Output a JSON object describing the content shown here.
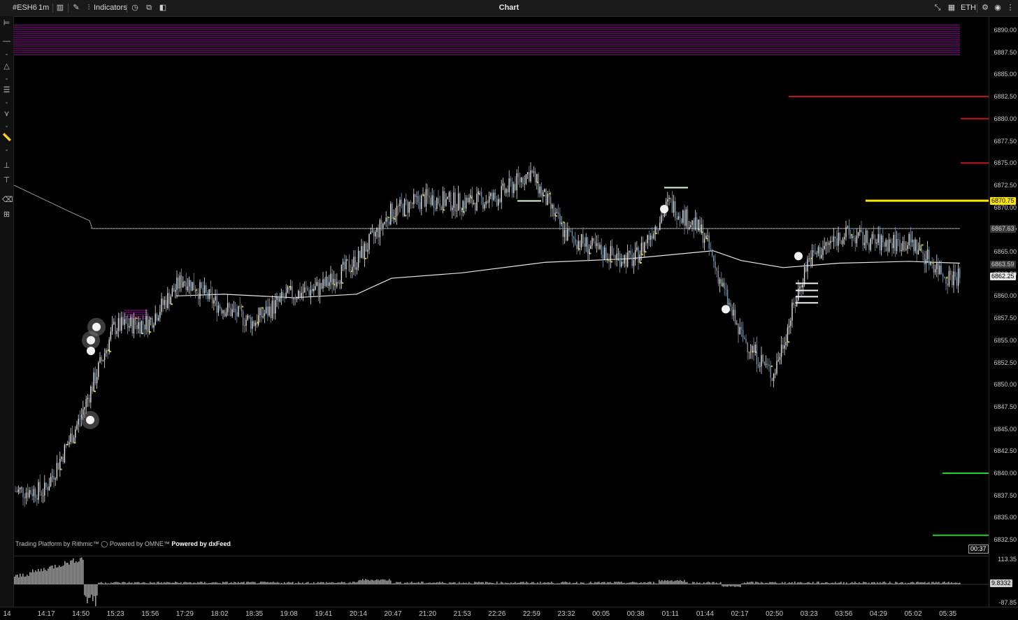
{
  "titlebar": {
    "symbol": "#ESH6",
    "interval": "1m",
    "indicators_label": "Indicators",
    "title": "Chart",
    "session": "ETH"
  },
  "price_axis": {
    "labels": [
      "6890.00",
      "6887.50",
      "6885.00",
      "6882.50",
      "6880.00",
      "6877.50",
      "6875.00",
      "6872.50",
      "6870.00",
      "6867.50",
      "6865.00",
      "6862.50",
      "6860.00",
      "6857.50",
      "6855.00",
      "6852.50",
      "6850.00",
      "6847.50",
      "6845.00",
      "6842.50",
      "6840.00",
      "6837.50",
      "6835.00",
      "6832.50"
    ],
    "tags": [
      {
        "text": "6870.75",
        "bg": "#ffe600",
        "fg": "#000000"
      },
      {
        "text": "6867.63",
        "bg": "#3a3a3a",
        "fg": "#cfcfcf"
      },
      {
        "text": "6863.59",
        "bg": "#3a3a3a",
        "fg": "#cfcfcf"
      },
      {
        "text": "6862.25",
        "bg": "#e6e6e6",
        "fg": "#000000"
      }
    ]
  },
  "volume_axis": {
    "top": "113.35",
    "bottom": "-87.85",
    "tag": "9.8332"
  },
  "time_axis": [
    "14",
    "14:17",
    "14:50",
    "15:23",
    "15:56",
    "17:29",
    "18:02",
    "18:35",
    "19:08",
    "19:41",
    "20:14",
    "20:47",
    "21:20",
    "21:53",
    "22:26",
    "22:59",
    "23:32",
    "00:05",
    "00:38",
    "01:11",
    "01:44",
    "02:17",
    "02:50",
    "03:23",
    "03:56",
    "04:29",
    "05:02",
    "05:35"
  ],
  "credits": {
    "rithmic": "Trading Platform by Rithmic™",
    "omne": "Powered by OMNE™",
    "dxfeed": "Powered by dxFeed"
  },
  "timer": "00:37",
  "colors": {
    "resistance": "#c01818",
    "support": "#22d022",
    "last_price": "#ffe600",
    "zone": "#b01ab0"
  },
  "chart_data": {
    "type": "candlestick",
    "price_levels": {
      "resistance": [
        6882.5,
        6880.0,
        6875.0
      ],
      "support": [
        6840.0,
        6833.0
      ],
      "last_price": 6870.75,
      "dotted_level": 6867.63,
      "vwap": 6863.59,
      "current": 6862.25
    },
    "approx_close_path": [
      {
        "t": "14:17",
        "p": 6838
      },
      {
        "t": "14:50",
        "p": 6846
      },
      {
        "t": "15:23",
        "p": 6856.5
      },
      {
        "t": "15:56",
        "p": 6857
      },
      {
        "t": "17:29",
        "p": 6862
      },
      {
        "t": "18:02",
        "p": 6859
      },
      {
        "t": "18:35",
        "p": 6857
      },
      {
        "t": "19:08",
        "p": 6860
      },
      {
        "t": "19:41",
        "p": 6861
      },
      {
        "t": "20:14",
        "p": 6864
      },
      {
        "t": "20:47",
        "p": 6869.5
      },
      {
        "t": "21:20",
        "p": 6871
      },
      {
        "t": "21:53",
        "p": 6870.5
      },
      {
        "t": "22:26",
        "p": 6871
      },
      {
        "t": "22:59",
        "p": 6874
      },
      {
        "t": "23:32",
        "p": 6867
      },
      {
        "t": "00:05",
        "p": 6865
      },
      {
        "t": "00:38",
        "p": 6864
      },
      {
        "t": "01:11",
        "p": 6870.5
      },
      {
        "t": "01:44",
        "p": 6867
      },
      {
        "t": "02:17",
        "p": 6856
      },
      {
        "t": "02:50",
        "p": 6851
      },
      {
        "t": "03:23",
        "p": 6864
      },
      {
        "t": "03:56",
        "p": 6867
      },
      {
        "t": "04:29",
        "p": 6866
      },
      {
        "t": "05:02",
        "p": 6866
      },
      {
        "t": "05:35",
        "p": 6862.25
      }
    ]
  }
}
